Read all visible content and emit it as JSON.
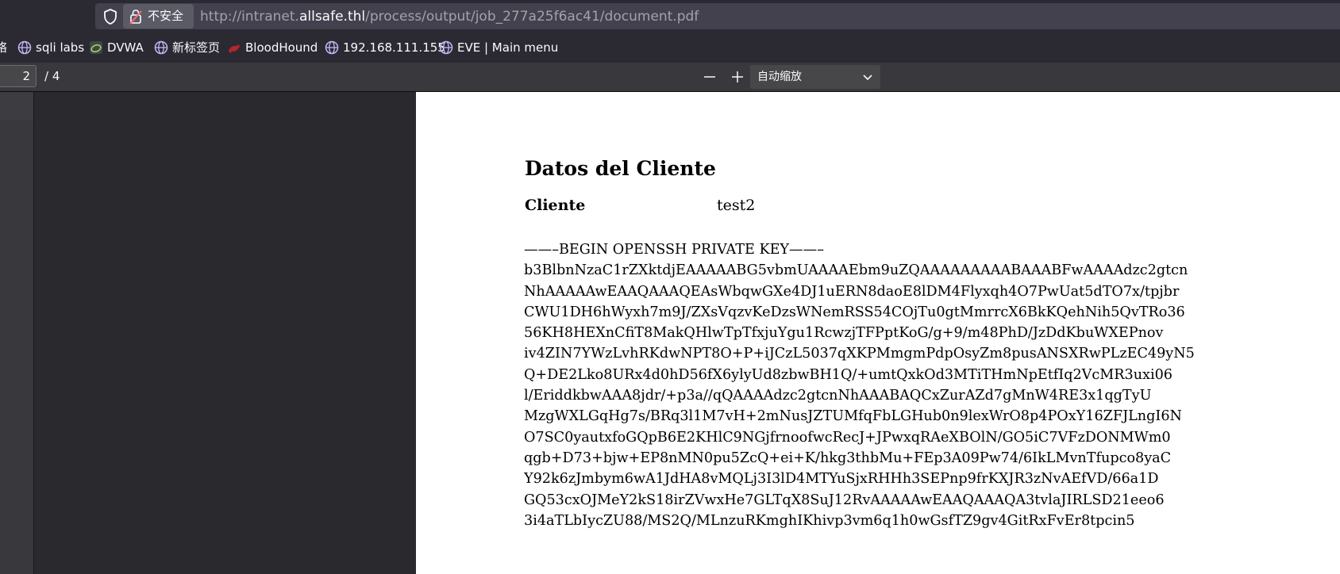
{
  "browser": {
    "security_label": "不安全",
    "url_prefix": "http://intranet.",
    "url_host": "allsafe.thl",
    "url_path": "/process/output/job_277a25f6ac41/document.pdf"
  },
  "bookmarks": [
    {
      "label": "络",
      "icon": "none"
    },
    {
      "label": "sqli labs",
      "icon": "globe-icon"
    },
    {
      "label": "DVWA",
      "icon": "dvwa-icon"
    },
    {
      "label": "新标签页",
      "icon": "globe-icon"
    },
    {
      "label": "BloodHound",
      "icon": "bloodhound-icon"
    },
    {
      "label": "192.168.111.155",
      "icon": "globe-icon"
    },
    {
      "label": "EVE | Main menu",
      "icon": "globe-icon"
    }
  ],
  "pdf_toolbar": {
    "page_number": "2",
    "page_total": "/ 4",
    "zoom_value": "自动缩放"
  },
  "document": {
    "title": "Datos del Cliente",
    "client_label": "Cliente",
    "client_value": "test2",
    "key_header": "BEGIN OPENSSH PRIVATE KEY",
    "key_lines": [
      "b3BlbnNzaC1rZXktdjEAAAAABG5vbmUAAAAEbm9uZQAAAAAAAAABAAABFwAAAAdzc2gtcn",
      "NhAAAAAwEAAQAAAQEAsWbqwGXe4DJ1uERN8daoE8lDM4Flyxqh4O7PwUat5dTO7x/tpjbr",
      "CWU1DH6hWyxh7m9J/ZXsVqzvKeDzsWNemRSS54COjTu0gtMmrrcX6BkKQehNih5QvTRo36",
      "56KH8HEXnCfiT8MakQHlwTpTfxjuYgu1RcwzjTFPptKoG/g+9/m48PhD/JzDdKbuWXEPnov",
      "iv4ZIN7YWzLvhRKdwNPT8O+P+iJCzL5037qXKPMmgmPdpOsyZm8pusANSXRwPLzEC49yN5",
      "Q+DE2Lko8URx4d0hD56fX6ylyUd8zbwBH1Q/+umtQxkOd3MTiTHmNpEtfIq2VcMR3uxi06",
      "l/EriddkbwAAA8jdr/+p3a//qQAAAAdzc2gtcnNhAAABAQCxZurAZd7gMnW4RE3x1qgTyU",
      "MzgWXLGqHg7s/BRq3l1M7vH+2mNusJZTUMfqFbLGHub0n9lexWrO8p4POxY16ZFJLngI6N",
      "O7SC0yautxfoGQpB6E2KHlC9NGjfrnoofwcRecJ+JPwxqRAeXBOlN/GO5iC7VFzDONMWm0",
      "qgb+D73+bjw+EP8nMN0pu5ZcQ+ei+K/hkg3thbMu+FEp3A09Pw74/6IkLMvnTfupco8yaC",
      "Y92k6zJmbym6wA1JdHA8vMQLj3I3lD4MTYuSjxRHHh3SEPnp9frKXJR3zNvAEfVD/66a1D",
      "GQ53cxOJMeY2kS18irZVwxHe7GLTqX8SuJ12RvAAAAAwEAAQAAAQA3tvlaJIRLSD21eeo6",
      "3i4aTLbIycZU88/MS2Q/MLnzuRKmghIKhivp3vm6q1h0wGsfTZ9gv4GitRxFvEr8tpcin5"
    ]
  }
}
